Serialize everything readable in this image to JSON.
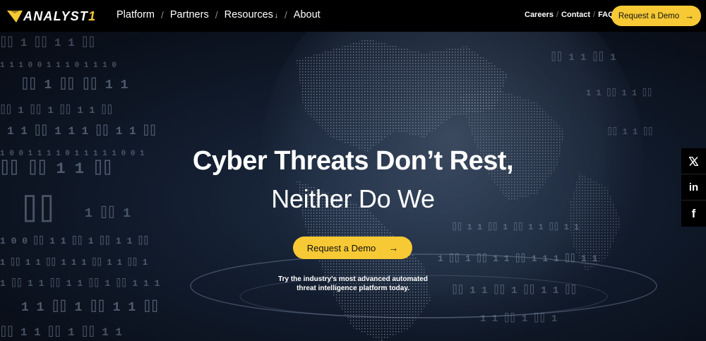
{
  "header": {
    "logo_text": "ANALYST",
    "logo_number": "1",
    "nav": [
      {
        "label": "Platform"
      },
      {
        "label": "Partners"
      },
      {
        "label": "Resources"
      },
      {
        "label": "About"
      }
    ],
    "resources_arrow": "↓",
    "nav_separator": "/",
    "util": [
      {
        "label": "Careers"
      },
      {
        "label": "Contact"
      },
      {
        "label": "FAQ"
      }
    ],
    "cta_label": "Request a Demo",
    "cta_arrow": "→"
  },
  "hero": {
    "headline": "Cyber Threats Don’t Rest,",
    "subheadline": "Neither Do We",
    "cta_label": "Request a Demo",
    "cta_arrow": "→",
    "tagline_line1": "Try the industry’s most advanced automated",
    "tagline_line2": "threat intelligence platform today."
  },
  "social": [
    {
      "icon": "x-icon",
      "glyph": "𝕏"
    },
    {
      "icon": "linkedin-icon",
      "glyph": "in"
    },
    {
      "icon": "facebook-icon",
      "glyph": "f"
    }
  ],
  "colors": {
    "accent": "#f7c934",
    "background": "#000000",
    "hero_bg": "#111b2c"
  }
}
